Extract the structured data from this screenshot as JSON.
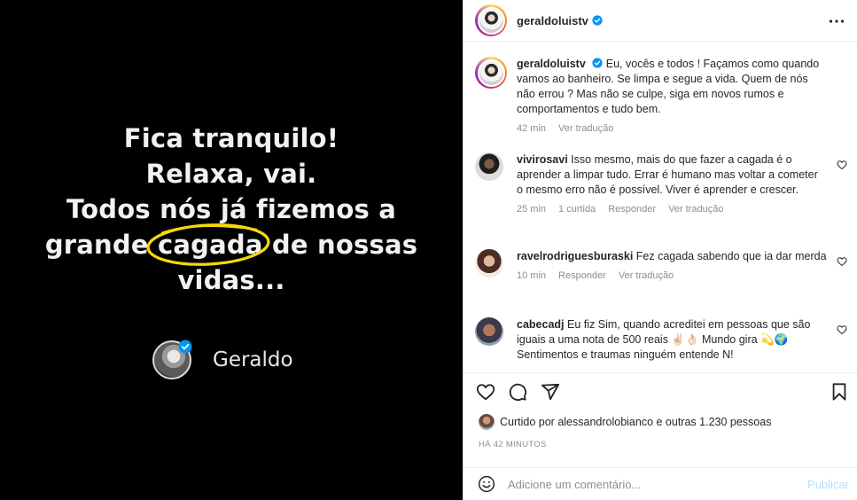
{
  "image": {
    "quote_lines": [
      "Fica tranquilo!",
      "Relaxa, vai.",
      "Todos nós já fizemos a",
      "grande cagada de nossas",
      "vidas..."
    ],
    "author_name": "Geraldo"
  },
  "header": {
    "username": "geraldoluistv",
    "more_icon": "more-horizontal-icon"
  },
  "caption": {
    "username": "geraldoluistv",
    "text": "Eu, vocês e todos ! Façamos como quando vamos ao banheiro. Se limpa e segue a vida. Quem de nós não errou ? Mas não se culpe, siga em novos rumos e comportamentos e tudo bem.",
    "time": "42 min",
    "translate": "Ver tradução"
  },
  "comments": [
    {
      "username": "vivirosavi",
      "text": "Isso mesmo, mais do que fazer a cagada é o aprender a limpar tudo. Errar é humano mas voltar a cometer o mesmo erro não é possível. Viver é aprender e crescer.",
      "time": "25 min",
      "likes": "1 curtida",
      "reply": "Responder",
      "translate": "Ver tradução"
    },
    {
      "username": "ravelrodriguesburaski",
      "text": "Fez cagada sabendo que ia dar merda",
      "time": "10 min",
      "reply": "Responder",
      "translate": "Ver tradução"
    },
    {
      "username": "cabecadj",
      "text": "Eu fiz Sim, quando acreditei em pessoas que são iguais a uma nota de 500 reais ✌🏻👌🏻 Mundo gira 💫🌍 Sentimentos e traumas ninguém entende N!"
    }
  ],
  "actions": {
    "liked_by_prefix": "Curtido por ",
    "liked_by_user": "alessandrolobianco",
    "liked_by_suffix": " e outras 1.230 pessoas",
    "time_ago": "HÁ 42 MINUTOS"
  },
  "add_comment": {
    "placeholder": "Adicione um comentário...",
    "publish_label": "Publicar"
  },
  "colors": {
    "verified": "#0095f6",
    "publish_disabled": "#b2dffc",
    "meta_gray": "#8e8e8e",
    "ring_yellow": "#f5d90a"
  }
}
